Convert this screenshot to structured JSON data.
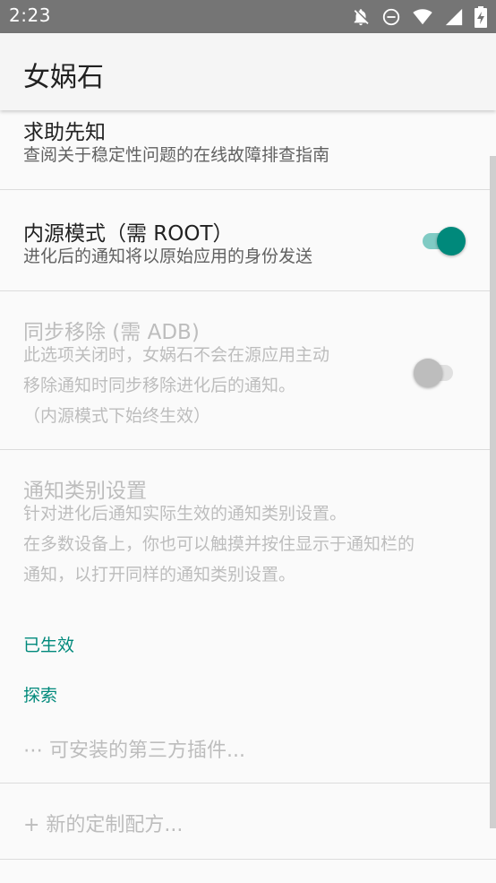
{
  "status_bar": {
    "time": "2:23",
    "icons": [
      "notifications-off-icon",
      "do-not-disturb-icon",
      "wifi-icon",
      "signal-icon",
      "battery-charging-icon"
    ]
  },
  "app_bar": {
    "title": "女娲石"
  },
  "preferences": {
    "help": {
      "title": "求助先知",
      "summary": "查阅关于稳定性问题的在线故障排查指南"
    },
    "source_mode": {
      "title": "内源模式（需 ROOT）",
      "summary": "进化后的通知将以原始应用的身份发送",
      "enabled": true
    },
    "sync_removal": {
      "title": "同步移除 (需 ADB)",
      "summary_lines": [
        "此选项关闭时，女娲石不会在源应用主动",
        "移除通知时同步移除进化后的通知。",
        "（内源模式下始终生效）"
      ],
      "enabled": false
    },
    "channel_settings": {
      "title": "通知类别设置",
      "summary_lines": [
        "针对进化后通知实际生效的通知类别设置。",
        "在多数设备上，你也可以触摸并按住显示于通知栏的",
        "通知，以打开同样的通知类别设置。"
      ]
    }
  },
  "categories": {
    "active": "已生效",
    "explore": "探索"
  },
  "explore_items": {
    "plugins": "⋯ 可安装的第三方插件...",
    "new_recipe": "+ 新的定制配方..."
  },
  "colors": {
    "accent": "#00897b",
    "status_bar": "#757575",
    "background": "#fafafa"
  }
}
